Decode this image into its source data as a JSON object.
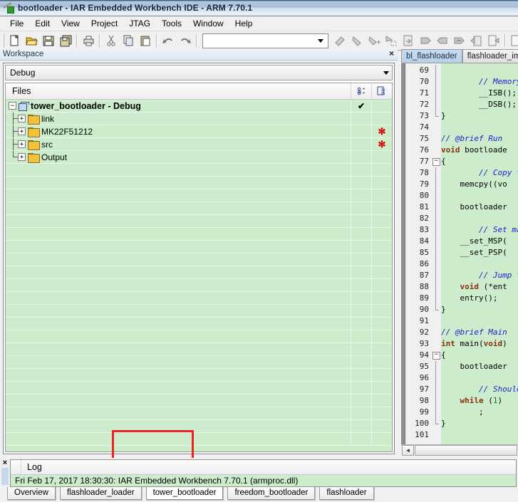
{
  "window": {
    "title": "bootloader - IAR Embedded Workbench IDE - ARM 7.70.1",
    "icon": "iar-workbench-icon"
  },
  "menu": {
    "items": [
      {
        "label": "File"
      },
      {
        "label": "Edit"
      },
      {
        "label": "View"
      },
      {
        "label": "Project"
      },
      {
        "label": "JTAG"
      },
      {
        "label": "Tools"
      },
      {
        "label": "Window"
      },
      {
        "label": "Help"
      }
    ]
  },
  "toolbar": {
    "buttons": [
      {
        "name": "new-document-icon"
      },
      {
        "name": "open-folder-icon"
      },
      {
        "name": "save-icon"
      },
      {
        "name": "save-all-icon"
      },
      {
        "name": "print-icon"
      },
      {
        "name": "cut-icon"
      },
      {
        "name": "copy-icon"
      },
      {
        "name": "paste-icon"
      },
      {
        "name": "undo-icon"
      },
      {
        "name": "redo-icon"
      }
    ],
    "search_combo": {
      "value": "",
      "placeholder": ""
    },
    "right_buttons": [
      {
        "name": "bookmark-toggle-icon"
      },
      {
        "name": "bookmark-previous-icon"
      },
      {
        "name": "bookmark-next-icon"
      },
      {
        "name": "navigate-backward-icon"
      },
      {
        "name": "go-to-definition-icon"
      },
      {
        "name": "find-icon"
      },
      {
        "name": "find-previous-icon"
      },
      {
        "name": "find-next-icon"
      },
      {
        "name": "replace-icon"
      },
      {
        "name": "find-in-files-icon"
      },
      {
        "name": "compile-icon"
      },
      {
        "name": "make-icon"
      },
      {
        "name": "debug-icon"
      }
    ]
  },
  "workspace": {
    "panel_title": "Workspace",
    "close_label": "×",
    "config_selected": "Debug",
    "tree_header": {
      "files_label": "Files",
      "col_build_icon": "build-status-icon",
      "col_flags_icon": "build-flags-icon"
    },
    "tree": [
      {
        "label": "tower_bootloader - Debug",
        "level": 0,
        "icon": "project-icon",
        "expander": "−",
        "col1": "✔",
        "col2": ""
      },
      {
        "label": "link",
        "level": 1,
        "icon": "folder-icon",
        "expander": "+",
        "col1": "",
        "col2": ""
      },
      {
        "label": "MK22F51212",
        "level": 1,
        "icon": "folder-icon",
        "expander": "+",
        "col1": "",
        "col2": "✻"
      },
      {
        "label": "src",
        "level": 1,
        "icon": "folder-icon",
        "expander": "+",
        "col1": "",
        "col2": "✻"
      },
      {
        "label": "Output",
        "level": 1,
        "icon": "folder-icon",
        "expander": "+",
        "col1": "",
        "col2": ""
      }
    ],
    "project_tabs": [
      {
        "label": "Overview",
        "active": false
      },
      {
        "label": "flashloader_loader",
        "active": false
      },
      {
        "label": "tower_bootloader",
        "active": true
      },
      {
        "label": "freedom_bootloader",
        "active": false
      },
      {
        "label": "flashloader",
        "active": false
      }
    ],
    "highlight_color": "#ee2222"
  },
  "editor": {
    "tabs": [
      {
        "label": "bl_flashloader",
        "active": true
      },
      {
        "label": "flashloader_image",
        "active": false
      }
    ],
    "first_line": 69,
    "lines": [
      {
        "n": 69,
        "text": "",
        "fold": ""
      },
      {
        "n": 70,
        "text": "        // Memory ",
        "fold": ""
      },
      {
        "n": 71,
        "text": "        __ISB();",
        "fold": ""
      },
      {
        "n": 72,
        "text": "        __DSB();",
        "fold": ""
      },
      {
        "n": 73,
        "text": "}",
        "fold": "end"
      },
      {
        "n": 74,
        "text": "",
        "fold": ""
      },
      {
        "n": 75,
        "text": "// @brief Run ",
        "fold": ""
      },
      {
        "n": 76,
        "text": "void bootloade",
        "fold": ""
      },
      {
        "n": 77,
        "text": "{",
        "fold": "start"
      },
      {
        "n": 78,
        "text": "        // Copy fl",
        "fold": ""
      },
      {
        "n": 79,
        "text": "    memcpy((vo",
        "fold": ""
      },
      {
        "n": 80,
        "text": "",
        "fold": ""
      },
      {
        "n": 81,
        "text": "    bootloader",
        "fold": ""
      },
      {
        "n": 82,
        "text": "",
        "fold": ""
      },
      {
        "n": 83,
        "text": "        // Set mai",
        "fold": ""
      },
      {
        "n": 84,
        "text": "    __set_MSP(",
        "fold": ""
      },
      {
        "n": 85,
        "text": "    __set_PSP(",
        "fold": ""
      },
      {
        "n": 86,
        "text": "",
        "fold": ""
      },
      {
        "n": 87,
        "text": "        // Jump to",
        "fold": ""
      },
      {
        "n": 88,
        "text": "    void (*ent",
        "fold": ""
      },
      {
        "n": 89,
        "text": "    entry();",
        "fold": ""
      },
      {
        "n": 90,
        "text": "}",
        "fold": "end"
      },
      {
        "n": 91,
        "text": "",
        "fold": ""
      },
      {
        "n": 92,
        "text": "// @brief Main",
        "fold": ""
      },
      {
        "n": 93,
        "text": "int main(void)",
        "fold": ""
      },
      {
        "n": 94,
        "text": "{",
        "fold": "start"
      },
      {
        "n": 95,
        "text": "    bootloader",
        "fold": ""
      },
      {
        "n": 96,
        "text": "",
        "fold": ""
      },
      {
        "n": 97,
        "text": "        // Should ",
        "fold": ""
      },
      {
        "n": 98,
        "text": "    while (1)",
        "fold": ""
      },
      {
        "n": 99,
        "text": "        ;",
        "fold": ""
      },
      {
        "n": 100,
        "text": "}",
        "fold": "end"
      },
      {
        "n": 101,
        "text": "",
        "fold": ""
      }
    ],
    "hscroll": {
      "left_arrow": "◄",
      "right_arrow": "►"
    }
  },
  "log": {
    "close_label": "×",
    "header_label": "Log",
    "rows": [
      "Fri Feb 17, 2017 18:30:30: IAR Embedded Workbench 7.70.1 (armproc.dll)"
    ]
  }
}
